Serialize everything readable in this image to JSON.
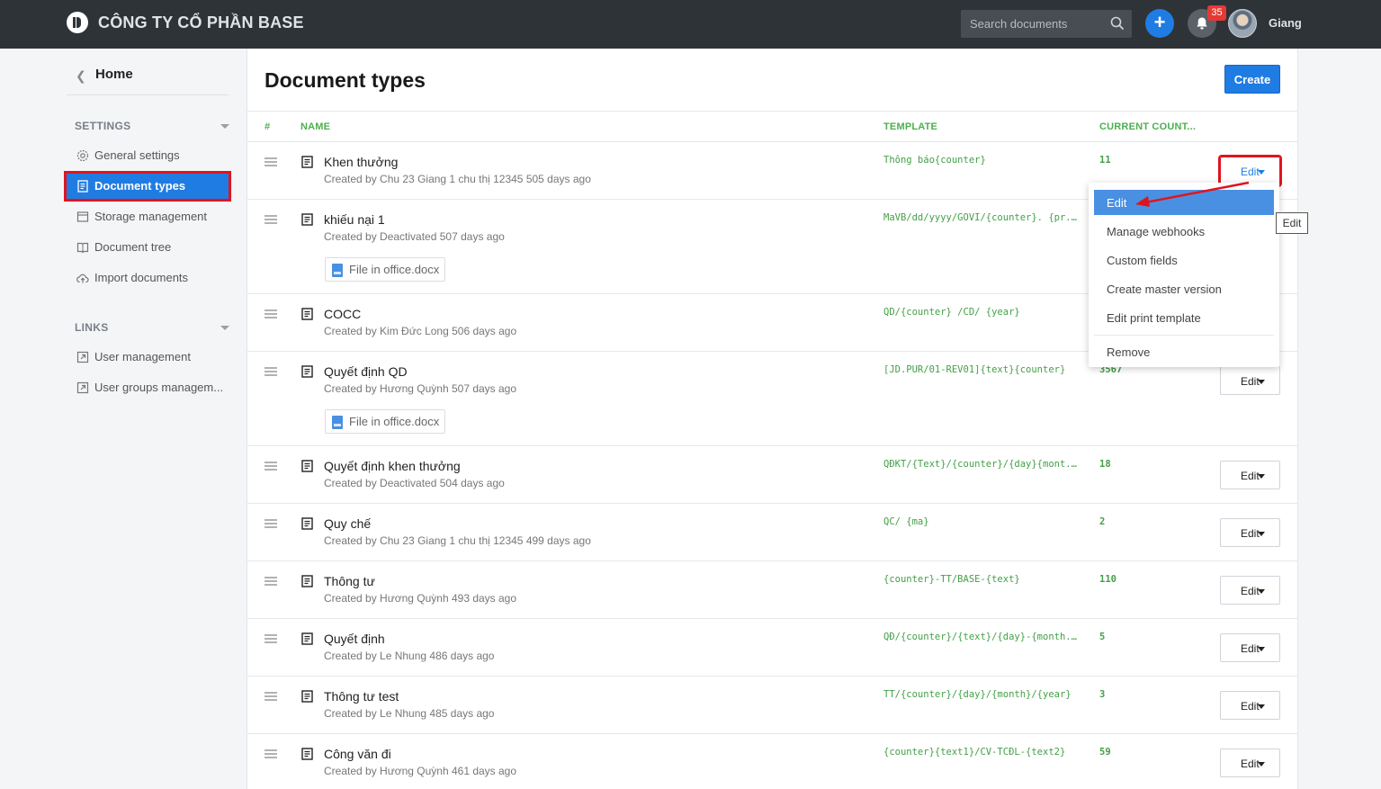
{
  "header": {
    "company": "CÔNG TY CỔ PHẦN BASE",
    "search_placeholder": "Search documents",
    "notification_count": "35",
    "username": "Giang",
    "plus_label": "+"
  },
  "sidebar": {
    "home_label": "Home",
    "settings_title": "SETTINGS",
    "settings_items": [
      {
        "label": "General settings",
        "icon": "gear-icon"
      },
      {
        "label": "Document types",
        "icon": "document-icon",
        "active": true
      },
      {
        "label": "Storage management",
        "icon": "storage-icon"
      },
      {
        "label": "Document tree",
        "icon": "book-icon"
      },
      {
        "label": "Import documents",
        "icon": "cloud-upload-icon"
      }
    ],
    "links_title": "LINKS",
    "links_items": [
      {
        "label": "User management",
        "icon": "external-link-icon"
      },
      {
        "label": "User groups managem...",
        "icon": "external-link-icon"
      }
    ]
  },
  "main": {
    "title": "Document types",
    "create_label": "Create",
    "columns": {
      "index": "#",
      "name": "NAME",
      "template": "TEMPLATE",
      "count": "CURRENT COUNT..."
    },
    "edit_label": "Edit",
    "rows": [
      {
        "name": "Khen thưởng",
        "meta": "Created by Chu 23 Giang 1 chu thị 12345 505 days ago",
        "template": "Thông báo{counter}",
        "count": "11"
      },
      {
        "name": "khiếu nại 1",
        "meta": "Created by Deactivated 507 days ago",
        "template": "MaVB/dd/yyyy/GOVI/{counter}. {pr...",
        "count": "",
        "attachment": "File in office.docx"
      },
      {
        "name": "COCC",
        "meta": "Created by Kim Đức Long 506 days ago",
        "template": "QD/{counter} /CD/ {year}",
        "count": ""
      },
      {
        "name": "Quyết định QD",
        "meta": "Created by Hương Quỳnh 507 days ago",
        "template": "[JD.PUR/01-REV01]{text}{counter}",
        "count": "3567",
        "attachment": "File in office.docx"
      },
      {
        "name": "Quyết định khen thưởng",
        "meta": "Created by Deactivated 504 days ago",
        "template": "QĐKT/{Text}/{counter}/{day}{mont...",
        "count": "18"
      },
      {
        "name": "Quy chế",
        "meta": "Created by Chu 23 Giang 1 chu thị 12345 499 days ago",
        "template": "QC/ {ma}",
        "count": "2"
      },
      {
        "name": "Thông tư",
        "meta": "Created by Hương Quỳnh 493 days ago",
        "template": "{counter}-TT/BASE-{text}",
        "count": "110"
      },
      {
        "name": "Quyết định",
        "meta": "Created by Le Nhung 486 days ago",
        "template": "QĐ/{counter}/{text}/{day}-{month...",
        "count": "5"
      },
      {
        "name": "Thông tư test",
        "meta": "Created by Le Nhung 485 days ago",
        "template": "TT/{counter}/{day}/{month}/{year}",
        "count": "3"
      },
      {
        "name": "Công văn đi",
        "meta": "Created by Hương Quỳnh 461 days ago",
        "template": "{counter}{text1}/CV-TCĐL-{text2}",
        "count": "59"
      }
    ]
  },
  "dropdown": {
    "items": [
      "Edit",
      "Manage webhooks",
      "Custom fields",
      "Create master version",
      "Edit print template"
    ],
    "remove_label": "Remove",
    "selected": "Edit"
  },
  "tooltip": "Edit",
  "colors": {
    "topbar": "#2e3338",
    "accent": "#1f7ce3",
    "highlight": "#e0141e",
    "template_green": "#43a047"
  }
}
